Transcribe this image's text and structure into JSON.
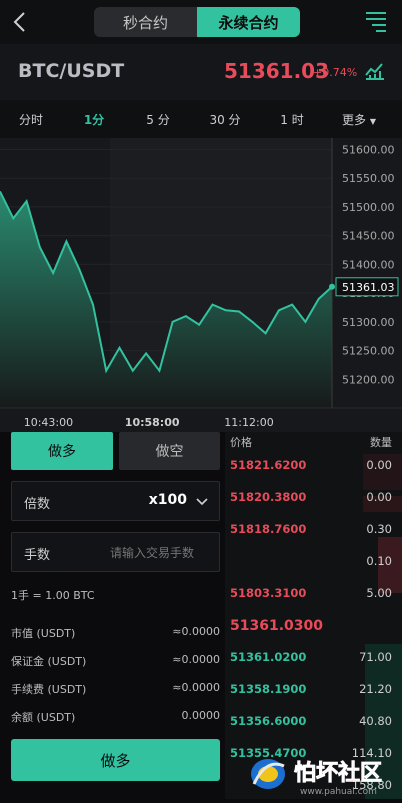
{
  "header": {
    "tabs": [
      "秒合约",
      "永续合约"
    ],
    "active_tab": 1
  },
  "pair": {
    "symbol": "BTC/USDT",
    "price": "51361.03",
    "change": "+0.74%"
  },
  "intervals": {
    "items": [
      "分时",
      "1分",
      "5 分",
      "30 分",
      "1 时",
      "更多"
    ],
    "active": 1
  },
  "chart_data": {
    "type": "area",
    "x": [
      "10:36",
      "10:38",
      "10:40",
      "10:41",
      "10:43",
      "10:45",
      "10:47",
      "10:49",
      "10:51",
      "10:53",
      "10:55",
      "10:57",
      "10:58",
      "11:00",
      "11:02",
      "11:04",
      "11:06",
      "11:08",
      "11:10",
      "11:12",
      "11:14",
      "11:16",
      "11:18",
      "11:20",
      "11:22",
      "11:24"
    ],
    "values": [
      51527,
      51480,
      51510,
      51430,
      51385,
      51440,
      51390,
      51330,
      51215,
      51255,
      51215,
      51245,
      51215,
      51300,
      51310,
      51295,
      51330,
      51320,
      51318,
      51300,
      51280,
      51320,
      51330,
      51300,
      51340,
      51361
    ],
    "y_ticks": [
      "51600.00",
      "51550.00",
      "51500.00",
      "51450.00",
      "51400.00",
      "51350.00",
      "51300.00",
      "51250.00",
      "51200.00"
    ],
    "x_ticks": [
      "10:43:00",
      "10:58:00",
      "11:12:00"
    ],
    "current_label": "51361.03",
    "ylim": [
      51150,
      51620
    ],
    "colors": {
      "line": "#33c2a0",
      "fill_top": "#2a8a6f",
      "fill_bottom": "#171a1a"
    }
  },
  "order_form": {
    "long_tab": "做多",
    "short_tab": "做空",
    "multiplier_label": "倍数",
    "multiplier_value": "x100",
    "qty_label": "手数",
    "qty_placeholder": "请输入交易手数",
    "lot_note": "1手 = 1.00 BTC",
    "info": [
      {
        "label": "市值 (USDT)",
        "value": "≈0.0000"
      },
      {
        "label": "保证金 (USDT)",
        "value": "≈0.0000"
      },
      {
        "label": "手续费 (USDT)",
        "value": "≈0.0000"
      },
      {
        "label": "余额 (USDT)",
        "value": "0.0000"
      }
    ],
    "submit_label": "做多"
  },
  "orderbook": {
    "price_header": "价格",
    "qty_header": "数量",
    "asks": [
      {
        "price": "51821.6200",
        "qty": "0.00"
      },
      {
        "price": "51820.3800",
        "qty": "0.00"
      },
      {
        "price": "51818.7600",
        "qty": "0.30"
      },
      {
        "price": "",
        "qty": "0.10"
      },
      {
        "price": "51803.3100",
        "qty": "5.00"
      }
    ],
    "last_price": "51361.0300",
    "bids": [
      {
        "price": "51361.0200",
        "qty": "71.00"
      },
      {
        "price": "51358.1900",
        "qty": "21.20"
      },
      {
        "price": "51356.6000",
        "qty": "40.80"
      },
      {
        "price": "51355.4700",
        "qty": "114.10"
      },
      {
        "price": "",
        "qty": "158.80"
      }
    ]
  },
  "watermark": {
    "brand": "怕坏社区",
    "url": "www.pahuai.com"
  }
}
